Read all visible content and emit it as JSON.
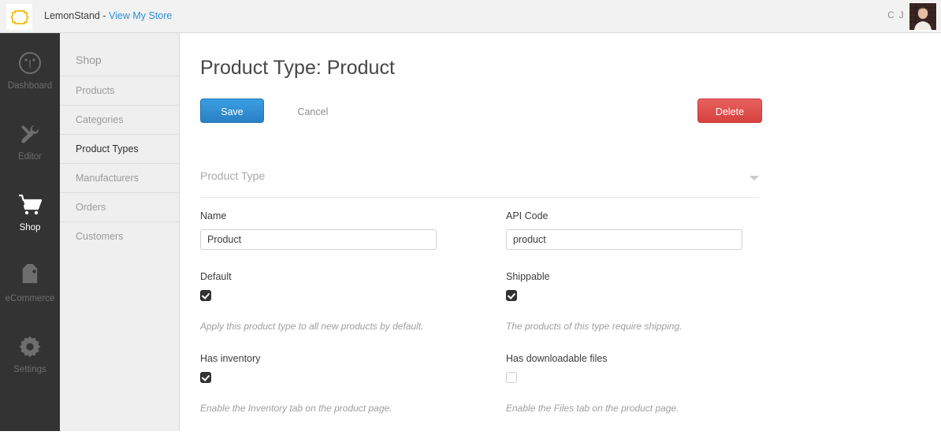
{
  "topbar": {
    "logo_icon": "lemonstand-logo-icon",
    "brand_name": "LemonStand - ",
    "store_link": "View My Store",
    "user_initials": "C J",
    "avatar_icon": "user-avatar",
    "link_color": "#2d8fd5"
  },
  "rail": {
    "items": [
      {
        "label": "Dashboard",
        "icon": "gauge-icon",
        "active": false
      },
      {
        "label": "Editor",
        "icon": "wrench-pencil-icon",
        "active": false
      },
      {
        "label": "Shop",
        "icon": "shopping-cart-icon",
        "active": true
      },
      {
        "label": "eCommerce",
        "icon": "price-tag-icon",
        "active": false
      },
      {
        "label": "Settings",
        "icon": "gear-icon",
        "active": false
      }
    ]
  },
  "subnav": {
    "title": "Shop",
    "items": [
      {
        "label": "Products",
        "active": false
      },
      {
        "label": "Categories",
        "active": false
      },
      {
        "label": "Product Types",
        "active": true
      },
      {
        "label": "Manufacturers",
        "active": false
      },
      {
        "label": "Orders",
        "active": false
      },
      {
        "label": "Customers",
        "active": false
      }
    ]
  },
  "main": {
    "page_title": "Product Type: Product",
    "buttons": {
      "save": "Save",
      "cancel": "Cancel",
      "delete": "Delete",
      "save_color": "#2a80c5",
      "delete_color": "#d6423f"
    },
    "section": {
      "label": "Product Type",
      "caret_icon": "chevron-down-icon"
    },
    "fields": {
      "name": {
        "label": "Name",
        "value": "Product"
      },
      "api_code": {
        "label": "API Code",
        "value": "product"
      },
      "default": {
        "label": "Default",
        "checked": true,
        "help": "Apply this product type to all new products by default."
      },
      "shippable": {
        "label": "Shippable",
        "checked": true,
        "help": "The products of this type require shipping."
      },
      "has_inventory": {
        "label": "Has inventory",
        "checked": true,
        "help": "Enable the Inventory tab on the product page."
      },
      "has_downloadable_files": {
        "label": "Has downloadable files",
        "checked": false,
        "help": "Enable the Files tab on the product page."
      }
    }
  }
}
